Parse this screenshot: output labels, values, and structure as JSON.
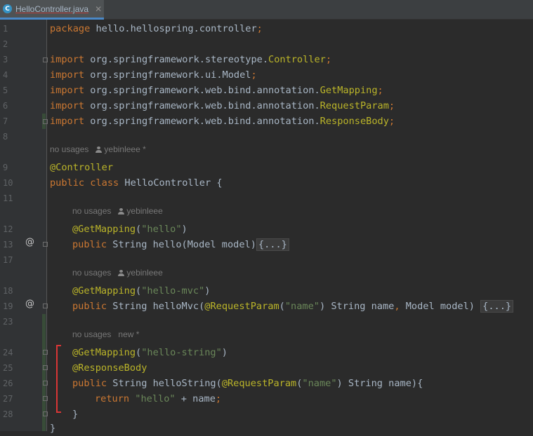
{
  "tab": {
    "icon": "C",
    "title": "HelloController.java",
    "close": "✕"
  },
  "line_numbers": [
    "1",
    "2",
    "3",
    "4",
    "5",
    "6",
    "7",
    "8",
    "9",
    "10",
    "11",
    "12",
    "13",
    "17",
    "18",
    "19",
    "23",
    "24",
    "25",
    "26",
    "27",
    "28"
  ],
  "hints": {
    "h1": {
      "usage": "no usages",
      "author": "yebinleee *"
    },
    "h2": {
      "usage": "no usages",
      "author": "yebinleee"
    },
    "h3": {
      "usage": "no usages",
      "author": "yebinleee"
    },
    "h4": {
      "usage": "no usages",
      "author": "new *"
    }
  },
  "gutter_markers": {
    "implements": "@"
  },
  "code": {
    "l1": {
      "kw": "package",
      "rest": " hello.hellospring.controller",
      "semi": ";"
    },
    "l3": {
      "kw": "import",
      "pkg": " org.springframework.stereotype.",
      "cls": "Controller",
      "semi": ";"
    },
    "l4": {
      "kw": "import",
      "pkg": " org.springframework.ui.Model",
      "semi": ";"
    },
    "l5": {
      "kw": "import",
      "pkg": " org.springframework.web.bind.annotation.",
      "cls": "GetMapping",
      "semi": ";"
    },
    "l6": {
      "kw": "import",
      "pkg": " org.springframework.web.bind.annotation.",
      "cls": "RequestParam",
      "semi": ";"
    },
    "l7": {
      "kw": "import",
      "pkg": " org.springframework.web.bind.annotation.",
      "cls": "ResponseBody",
      "semi": ";"
    },
    "l9": {
      "ann": "@Controller"
    },
    "l10": {
      "kw1": "public",
      "kw2": " class",
      "name": " HelloController",
      "brace": " {"
    },
    "l12": {
      "ann": "@GetMapping",
      "open": "(",
      "str": "\"hello\"",
      "close": ")"
    },
    "l13": {
      "kw": "public",
      "type": " String",
      "method": " hello",
      "params": "(Model model)",
      "folded": "{...}"
    },
    "l18": {
      "ann": "@GetMapping",
      "open": "(",
      "str": "\"hello-mvc\"",
      "close": ")"
    },
    "l19": {
      "kw": "public",
      "type": " String",
      "method": " helloMvc",
      "p1": "(",
      "ann": "@RequestParam",
      "p2": "(",
      "str": "\"name\"",
      "p3": ") String name",
      "comma": ",",
      "p4": " Model model) ",
      "folded": "{...}"
    },
    "l24": {
      "ann": "@GetMapping",
      "open": "(",
      "str": "\"hello-string\"",
      "close": ")"
    },
    "l25": {
      "ann": "@ResponseBody"
    },
    "l26": {
      "kw": "public",
      "type": " String",
      "method": " helloString",
      "p1": "(",
      "ann": "@RequestParam",
      "p2": "(",
      "str": "\"name\"",
      "p3": ") String name){"
    },
    "l27": {
      "kw": "return",
      "str": " \"hello\"",
      "rest": " + name",
      "semi": ";"
    },
    "l28": {
      "brace": "}"
    },
    "l29": {
      "brace": "}"
    }
  }
}
